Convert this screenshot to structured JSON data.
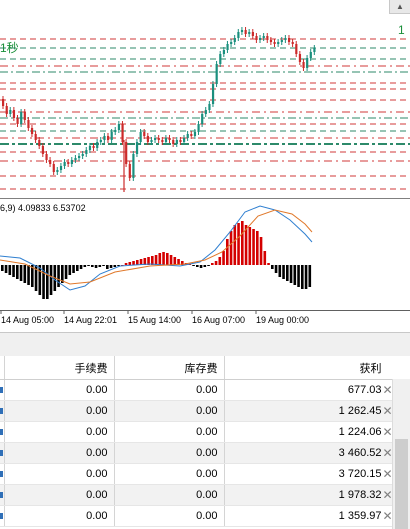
{
  "price_chart": {
    "label_left": "1秒",
    "label_right": "1"
  },
  "oscillator": {
    "info_text": "6,9) 4.09833 6.53702"
  },
  "time_axis": {
    "labels": [
      "14 Aug 05:00",
      "14 Aug 22:01",
      "15 Aug 14:00",
      "16 Aug 07:00",
      "19 Aug 00:00"
    ]
  },
  "colors": {
    "bull_candle": "#1a8f7e",
    "bear_candle": "#cc2a2a",
    "green_level": "#2d8a6a",
    "red_level": "#d23a3a",
    "hist_pos": "#d40000",
    "hist_neg": "#000000",
    "signal_blue": "#2f7fd0",
    "signal_orange": "#e0782a"
  },
  "icons": {
    "close": "close-x-icon",
    "marker": "position-marker-icon"
  },
  "table": {
    "columns": [
      "手续费",
      "库存费",
      "获利"
    ],
    "close_symbol": "✕",
    "rows": [
      {
        "commission": "0.00",
        "swap": "0.00",
        "profit": "677.03"
      },
      {
        "commission": "0.00",
        "swap": "0.00",
        "profit": "1 262.45"
      },
      {
        "commission": "0.00",
        "swap": "0.00",
        "profit": "1 224.06"
      },
      {
        "commission": "0.00",
        "swap": "0.00",
        "profit": "3 460.52"
      },
      {
        "commission": "0.00",
        "swap": "0.00",
        "profit": "3 720.15"
      },
      {
        "commission": "0.00",
        "swap": "0.00",
        "profit": "1 978.32"
      },
      {
        "commission": "0.00",
        "swap": "0.00",
        "profit": "1 359.97"
      }
    ]
  }
}
